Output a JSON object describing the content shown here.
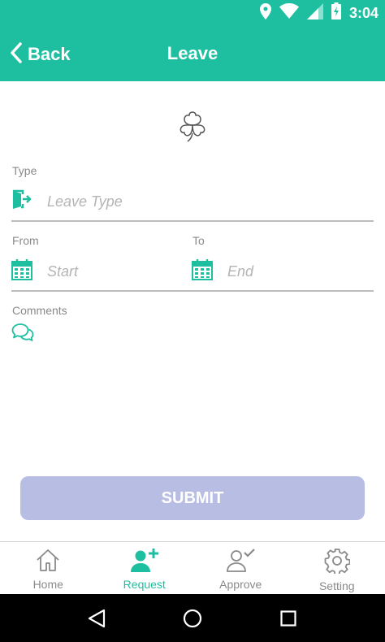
{
  "status_bar": {
    "time": "3:04",
    "icons": [
      "location-icon",
      "wifi-icon",
      "signal-icon",
      "battery-charging-icon"
    ]
  },
  "header": {
    "back_label": "Back",
    "title": "Leave",
    "color": "#1ebfa0"
  },
  "logo": {
    "icon": "clover-icon"
  },
  "form": {
    "type": {
      "label": "Type",
      "placeholder": "Leave Type",
      "icon": "exit-door-icon"
    },
    "from": {
      "label": "From",
      "placeholder": "Start",
      "icon": "calendar-icon"
    },
    "to": {
      "label": "To",
      "placeholder": "End",
      "icon": "calendar-icon"
    },
    "comments": {
      "label": "Comments",
      "icon": "chat-bubbles-icon"
    }
  },
  "submit": {
    "label": "SUBMIT",
    "color": "#b8bee3"
  },
  "bottom_nav": {
    "items": [
      {
        "label": "Home",
        "icon": "home-icon",
        "active": false
      },
      {
        "label": "Request",
        "icon": "add-user-icon",
        "active": true
      },
      {
        "label": "Approve",
        "icon": "user-check-icon",
        "active": false
      },
      {
        "label": "Setting",
        "icon": "gear-icon",
        "active": false
      }
    ]
  },
  "system_nav": {
    "icons": [
      "back-triangle-icon",
      "home-circle-icon",
      "recents-square-icon"
    ]
  }
}
